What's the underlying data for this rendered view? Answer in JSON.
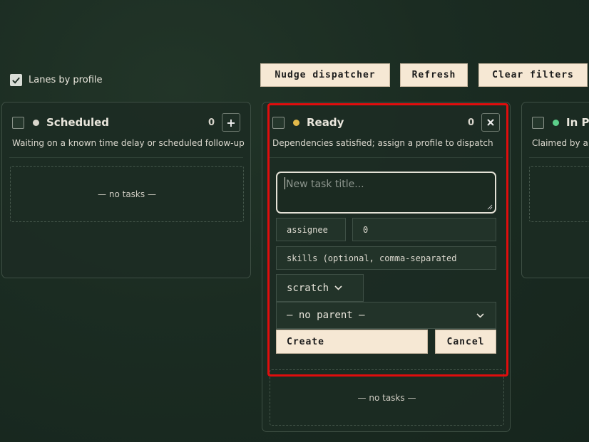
{
  "toolbar": {
    "lanes_by_profile_label": "Lanes by profile",
    "lanes_by_profile_checked": true,
    "nudge_label": "Nudge dispatcher",
    "refresh_label": "Refresh",
    "clear_filters_label": "Clear filters"
  },
  "lanes": [
    {
      "title": "Scheduled",
      "count": "0",
      "description": "Waiting on a known time delay or scheduled follow-up",
      "empty_text": "— no tasks —",
      "dot_color": "#d9d6cc",
      "action_icon": "plus-icon"
    },
    {
      "title": "Ready",
      "count": "0",
      "description": "Dependencies satisfied; assign a profile to dispatch",
      "empty_text": "— no tasks —",
      "dot_color": "#e2b94a",
      "action_icon": "close-icon"
    },
    {
      "title": "In Pr",
      "description": "Claimed by a w",
      "dot_color": "#5ccf8a"
    }
  ],
  "new_task_form": {
    "title_placeholder": "New task title...",
    "assignee_label": "assignee",
    "priority_value": "0",
    "skills_placeholder": "skills (optional, comma-separated",
    "workspace_value": "scratch",
    "parent_value": "— no parent —",
    "create_label": "Create",
    "cancel_label": "Cancel"
  },
  "highlight_color": "#e00d0d"
}
